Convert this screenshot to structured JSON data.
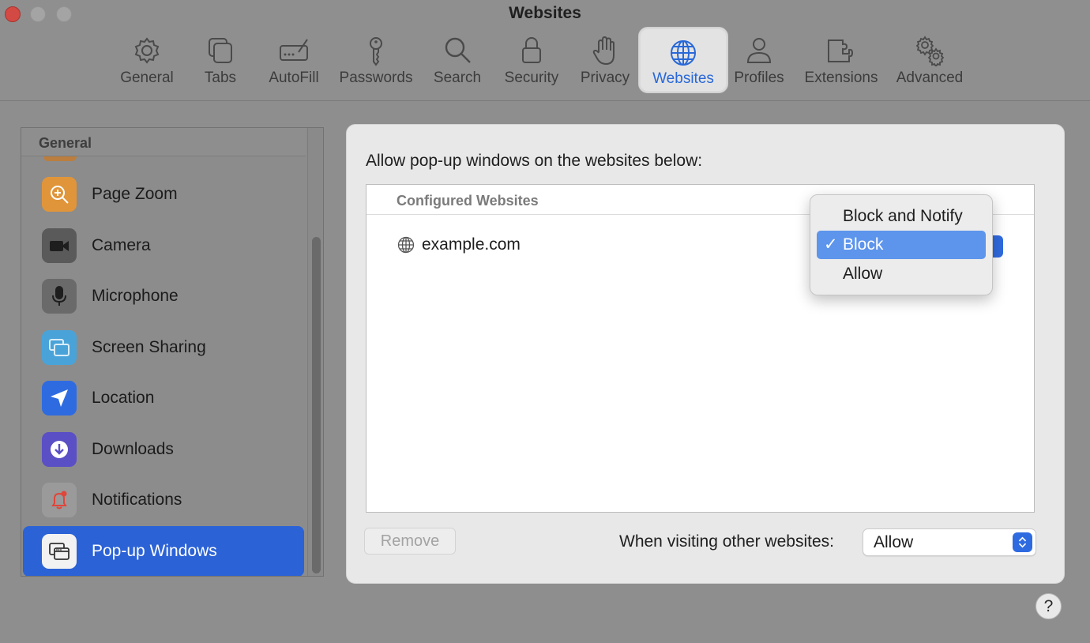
{
  "window": {
    "title": "Websites"
  },
  "toolbar": {
    "items": [
      {
        "label": "General",
        "icon": "gear-icon"
      },
      {
        "label": "Tabs",
        "icon": "tabs-icon"
      },
      {
        "label": "AutoFill",
        "icon": "autofill-icon"
      },
      {
        "label": "Passwords",
        "icon": "key-icon"
      },
      {
        "label": "Search",
        "icon": "search-icon"
      },
      {
        "label": "Security",
        "icon": "lock-icon"
      },
      {
        "label": "Privacy",
        "icon": "hand-icon"
      },
      {
        "label": "Websites",
        "icon": "globe-icon",
        "selected": true
      },
      {
        "label": "Profiles",
        "icon": "person-icon"
      },
      {
        "label": "Extensions",
        "icon": "puzzle-icon"
      },
      {
        "label": "Advanced",
        "icon": "gears-icon"
      }
    ]
  },
  "sidebar": {
    "header": "General",
    "items": [
      {
        "label": "Page Zoom",
        "icon": "zoom-icon",
        "color": "#e0953a"
      },
      {
        "label": "Camera",
        "icon": "camera-icon",
        "color": "#4a4a4a"
      },
      {
        "label": "Microphone",
        "icon": "microphone-icon",
        "color": "#5a5a5a"
      },
      {
        "label": "Screen Sharing",
        "icon": "screen-sharing-icon",
        "color": "#3c9bd6"
      },
      {
        "label": "Location",
        "icon": "location-arrow-icon",
        "color": "#2f6be0"
      },
      {
        "label": "Downloads",
        "icon": "download-icon",
        "color": "#5a4fc4"
      },
      {
        "label": "Notifications",
        "icon": "bell-icon",
        "color": "#e0453a"
      },
      {
        "label": "Pop-up Windows",
        "icon": "popup-windows-icon",
        "selected": true
      }
    ]
  },
  "main": {
    "heading": "Allow pop-up windows on the websites below:",
    "list_header": "Configured Websites",
    "sites": [
      {
        "name": "example.com",
        "setting": "Block"
      }
    ],
    "remove_label": "Remove",
    "other_websites_label": "When visiting other websites:",
    "other_websites_value": "Allow"
  },
  "popup_menu": {
    "options": [
      {
        "label": "Block and Notify",
        "checked": false
      },
      {
        "label": "Block",
        "checked": true
      },
      {
        "label": "Allow",
        "checked": false
      }
    ],
    "check_glyph": "✓"
  },
  "help_label": "?",
  "colors": {
    "accent": "#2b62d6",
    "menu_highlight": "#5d95ec"
  }
}
